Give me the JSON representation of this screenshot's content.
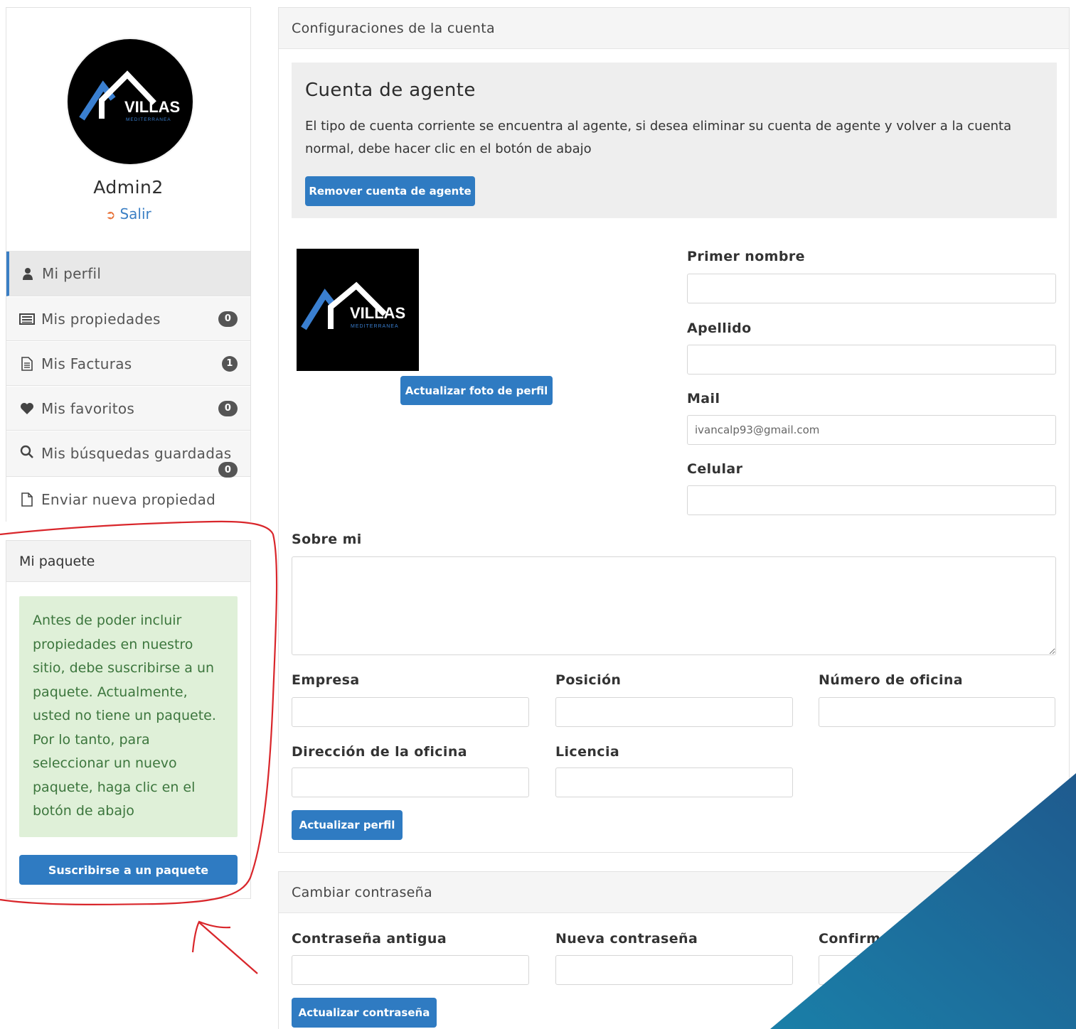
{
  "sidebar": {
    "logo_text": "VILLAS",
    "logo_subtext": "MEDITERRANEA",
    "username": "Admin2",
    "logout_label": "Salir",
    "items": [
      {
        "label": "Mi perfil",
        "icon": "user-icon",
        "badge": null
      },
      {
        "label": "Mis propiedades",
        "icon": "list-icon",
        "badge": "0"
      },
      {
        "label": "Mis Facturas",
        "icon": "file-text-icon",
        "badge": "1"
      },
      {
        "label": "Mis favoritos",
        "icon": "heart-icon",
        "badge": "0"
      },
      {
        "label": "Mis búsquedas guardadas",
        "icon": "search-icon",
        "badge": "0"
      },
      {
        "label": "Enviar nueva propiedad",
        "icon": "file-icon",
        "badge": null
      }
    ]
  },
  "package": {
    "title": "Mi paquete",
    "message": "Antes de poder incluir propiedades en nuestro sitio, debe suscribirse a un paquete. Actualmente, usted no tiene un paquete. Por lo tanto, para seleccionar un nuevo paquete, haga clic en el botón de abajo",
    "button_label": "Suscribirse a un paquete"
  },
  "account": {
    "panel_title": "Configuraciones de la cuenta",
    "agent_title": "Cuenta de agente",
    "agent_text": "El tipo de cuenta corriente se encuentra al agente, si desea eliminar su cuenta de agente y volver a la cuenta normal, debe hacer clic en el botón de abajo",
    "remove_agent_label": "Remover cuenta de agente",
    "photo_logo_text": "VILLAS",
    "photo_logo_subtext": "MEDITERRANEA",
    "update_photo_label": "Actualizar foto de perfil",
    "fields": {
      "first_name": {
        "label": "Primer nombre",
        "value": ""
      },
      "last_name": {
        "label": "Apellido",
        "value": ""
      },
      "mail": {
        "label": "Mail",
        "placeholder": "ivancalp93@gmail.com"
      },
      "mobile": {
        "label": "Celular",
        "value": ""
      },
      "about": {
        "label": "Sobre mi",
        "value": ""
      },
      "company": {
        "label": "Empresa",
        "value": ""
      },
      "position": {
        "label": "Posición",
        "value": ""
      },
      "office_number": {
        "label": "Número de oficina",
        "value": ""
      },
      "office_address": {
        "label": "Dirección de la oficina",
        "value": ""
      },
      "license": {
        "label": "Licencia",
        "value": ""
      }
    },
    "update_profile_label": "Actualizar perfil"
  },
  "password": {
    "panel_title": "Cambiar contraseña",
    "old_label": "Contraseña antigua",
    "new_label": "Nueva contraseña",
    "confirm_label": "Confirma",
    "update_label": "Actualizar contraseña"
  },
  "colors": {
    "accent": "#2f7bc2",
    "alert_bg": "#dff0d8",
    "alert_text": "#3c763d",
    "annotation": "#d9262b",
    "corner": "#1d5f93"
  }
}
